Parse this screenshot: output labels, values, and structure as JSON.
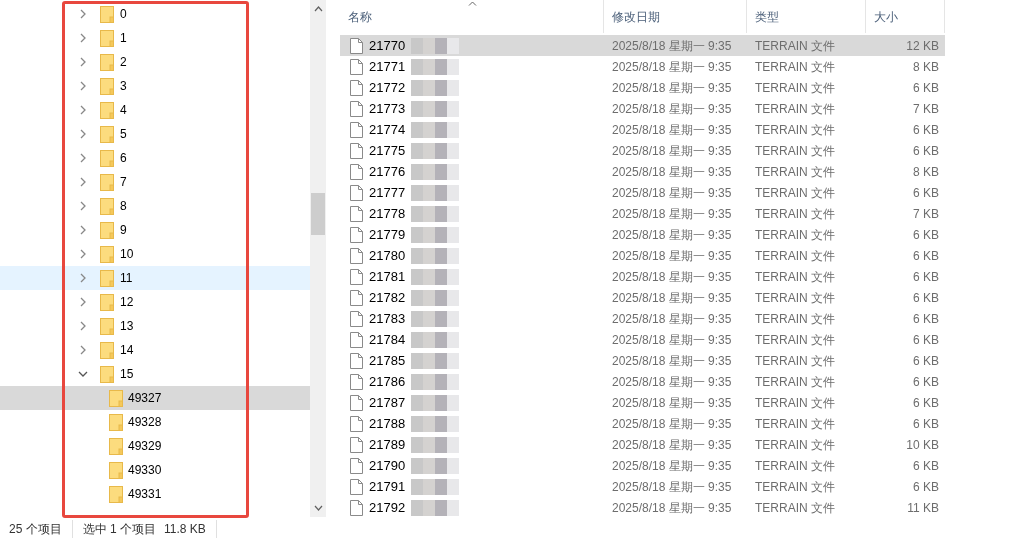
{
  "tree": [
    {
      "label": "0",
      "expanded": false,
      "hovered": false,
      "selected": false
    },
    {
      "label": "1",
      "expanded": false,
      "hovered": false,
      "selected": false
    },
    {
      "label": "2",
      "expanded": false,
      "hovered": false,
      "selected": false
    },
    {
      "label": "3",
      "expanded": false,
      "hovered": false,
      "selected": false
    },
    {
      "label": "4",
      "expanded": false,
      "hovered": false,
      "selected": false
    },
    {
      "label": "5",
      "expanded": false,
      "hovered": false,
      "selected": false
    },
    {
      "label": "6",
      "expanded": false,
      "hovered": false,
      "selected": false
    },
    {
      "label": "7",
      "expanded": false,
      "hovered": false,
      "selected": false
    },
    {
      "label": "8",
      "expanded": false,
      "hovered": false,
      "selected": false
    },
    {
      "label": "9",
      "expanded": false,
      "hovered": false,
      "selected": false
    },
    {
      "label": "10",
      "expanded": false,
      "hovered": false,
      "selected": false
    },
    {
      "label": "11",
      "expanded": false,
      "hovered": true,
      "selected": false
    },
    {
      "label": "12",
      "expanded": false,
      "hovered": false,
      "selected": false
    },
    {
      "label": "13",
      "expanded": false,
      "hovered": false,
      "selected": false
    },
    {
      "label": "14",
      "expanded": false,
      "hovered": false,
      "selected": false
    },
    {
      "label": "15",
      "expanded": true,
      "hovered": false,
      "selected": false,
      "children": [
        {
          "label": "49327",
          "hovered": false,
          "selected": true
        },
        {
          "label": "49328",
          "hovered": false,
          "selected": false
        },
        {
          "label": "49329",
          "hovered": false,
          "selected": false
        },
        {
          "label": "49330",
          "hovered": false,
          "selected": false
        },
        {
          "label": "49331",
          "hovered": false,
          "selected": false
        }
      ]
    }
  ],
  "table": {
    "columns": [
      "名称",
      "修改日期",
      "类型",
      "大小"
    ],
    "rows": [
      {
        "name": "21770",
        "date": "2025/8/18 星期一 9:35",
        "type": "TERRAIN 文件",
        "size": "12 KB",
        "selected": true
      },
      {
        "name": "21771",
        "date": "2025/8/18 星期一 9:35",
        "type": "TERRAIN 文件",
        "size": "8 KB",
        "selected": false
      },
      {
        "name": "21772",
        "date": "2025/8/18 星期一 9:35",
        "type": "TERRAIN 文件",
        "size": "6 KB",
        "selected": false
      },
      {
        "name": "21773",
        "date": "2025/8/18 星期一 9:35",
        "type": "TERRAIN 文件",
        "size": "7 KB",
        "selected": false
      },
      {
        "name": "21774",
        "date": "2025/8/18 星期一 9:35",
        "type": "TERRAIN 文件",
        "size": "6 KB",
        "selected": false
      },
      {
        "name": "21775",
        "date": "2025/8/18 星期一 9:35",
        "type": "TERRAIN 文件",
        "size": "6 KB",
        "selected": false
      },
      {
        "name": "21776",
        "date": "2025/8/18 星期一 9:35",
        "type": "TERRAIN 文件",
        "size": "8 KB",
        "selected": false
      },
      {
        "name": "21777",
        "date": "2025/8/18 星期一 9:35",
        "type": "TERRAIN 文件",
        "size": "6 KB",
        "selected": false
      },
      {
        "name": "21778",
        "date": "2025/8/18 星期一 9:35",
        "type": "TERRAIN 文件",
        "size": "7 KB",
        "selected": false
      },
      {
        "name": "21779",
        "date": "2025/8/18 星期一 9:35",
        "type": "TERRAIN 文件",
        "size": "6 KB",
        "selected": false
      },
      {
        "name": "21780",
        "date": "2025/8/18 星期一 9:35",
        "type": "TERRAIN 文件",
        "size": "6 KB",
        "selected": false
      },
      {
        "name": "21781",
        "date": "2025/8/18 星期一 9:35",
        "type": "TERRAIN 文件",
        "size": "6 KB",
        "selected": false
      },
      {
        "name": "21782",
        "date": "2025/8/18 星期一 9:35",
        "type": "TERRAIN 文件",
        "size": "6 KB",
        "selected": false
      },
      {
        "name": "21783",
        "date": "2025/8/18 星期一 9:35",
        "type": "TERRAIN 文件",
        "size": "6 KB",
        "selected": false
      },
      {
        "name": "21784",
        "date": "2025/8/18 星期一 9:35",
        "type": "TERRAIN 文件",
        "size": "6 KB",
        "selected": false
      },
      {
        "name": "21785",
        "date": "2025/8/18 星期一 9:35",
        "type": "TERRAIN 文件",
        "size": "6 KB",
        "selected": false
      },
      {
        "name": "21786",
        "date": "2025/8/18 星期一 9:35",
        "type": "TERRAIN 文件",
        "size": "6 KB",
        "selected": false
      },
      {
        "name": "21787",
        "date": "2025/8/18 星期一 9:35",
        "type": "TERRAIN 文件",
        "size": "6 KB",
        "selected": false
      },
      {
        "name": "21788",
        "date": "2025/8/18 星期一 9:35",
        "type": "TERRAIN 文件",
        "size": "6 KB",
        "selected": false
      },
      {
        "name": "21789",
        "date": "2025/8/18 星期一 9:35",
        "type": "TERRAIN 文件",
        "size": "10 KB",
        "selected": false
      },
      {
        "name": "21790",
        "date": "2025/8/18 星期一 9:35",
        "type": "TERRAIN 文件",
        "size": "6 KB",
        "selected": false
      },
      {
        "name": "21791",
        "date": "2025/8/18 星期一 9:35",
        "type": "TERRAIN 文件",
        "size": "6 KB",
        "selected": false
      },
      {
        "name": "21792",
        "date": "2025/8/18 星期一 9:35",
        "type": "TERRAIN 文件",
        "size": "11 KB",
        "selected": false
      }
    ]
  },
  "status_bar": {
    "item_count": "25 个项目",
    "selection": "选中 1 个项目",
    "selection_size": "11.8 KB"
  }
}
